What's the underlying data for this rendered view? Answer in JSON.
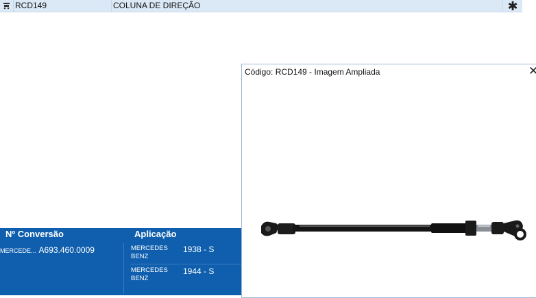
{
  "result_row": {
    "code": "RCD149",
    "description": "COLUNA DE DIREÇÃO",
    "star": "✱",
    "icon": "cart-icon"
  },
  "info_panel": {
    "header_conversion": "Nº Conversão",
    "header_application": "Aplicação",
    "conversion": {
      "brand": "MERCEDE...",
      "number": "A693.460.0009"
    },
    "applications": [
      {
        "brand": "MERCEDES BENZ",
        "year": "1938 - S"
      },
      {
        "brand": "MERCEDES BENZ",
        "year": "1944 - S"
      }
    ]
  },
  "dialog": {
    "title": "Código: RCD149 - Imagem Ampliada",
    "close": "✕",
    "image_icon": "steering-shaft-image"
  },
  "colors": {
    "row_bg": "#dbe9f7",
    "panel_bg": "#0f5fae",
    "dialog_border": "#9fb8d3"
  }
}
